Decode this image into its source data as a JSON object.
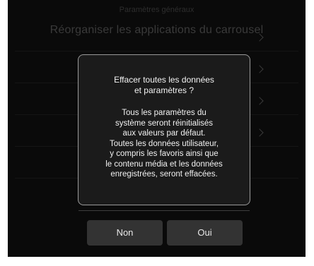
{
  "background": {
    "header": "Paramètres généraux",
    "title": "Réorganiser les applications du carrousel"
  },
  "dialog": {
    "title": "Effacer toutes les données\net paramètres ?",
    "message": "Tous les paramètres du\nsystème seront réinitialisés\naux valeurs par défaut.\nToutes les données utilisateur,\ny compris les favoris ainsi que\nle contenu média et les données\nenregistrées, seront effacées.",
    "buttons": {
      "no_label": "Non",
      "yes_label": "Oui"
    }
  },
  "colors": {
    "screen_background": "#0a0a0a",
    "dialog_background": "#1b1b1b",
    "dialog_border": "#9a9a9a",
    "button_background": "#333333",
    "text": "#f2f2f2"
  },
  "icons": [
    "chevron-right-icon"
  ]
}
